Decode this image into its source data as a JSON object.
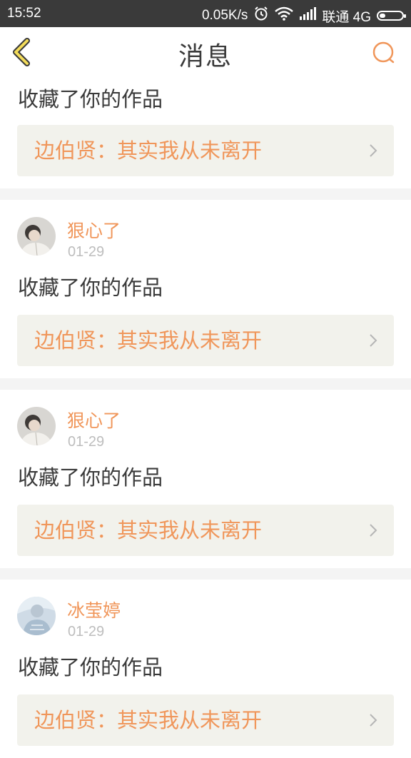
{
  "status_bar": {
    "time": "15:52",
    "net_speed": "0.05K/s",
    "carrier": "联通 4G"
  },
  "header": {
    "title": "消息",
    "accent_color": "#f0965a"
  },
  "messages": [
    {
      "show_user": false,
      "action": "收藏了你的作品",
      "work_title": "边伯贤：其实我从未离开"
    },
    {
      "show_user": true,
      "username": "狠心了",
      "date": "01-29",
      "action": "收藏了你的作品",
      "work_title": "边伯贤：其实我从未离开"
    },
    {
      "show_user": true,
      "username": "狠心了",
      "date": "01-29",
      "action": "收藏了你的作品",
      "work_title": "边伯贤：其实我从未离开"
    },
    {
      "show_user": true,
      "username": "冰莹婷",
      "date": "01-29",
      "action": "收藏了你的作品",
      "work_title": "边伯贤：其实我从未离开"
    }
  ]
}
